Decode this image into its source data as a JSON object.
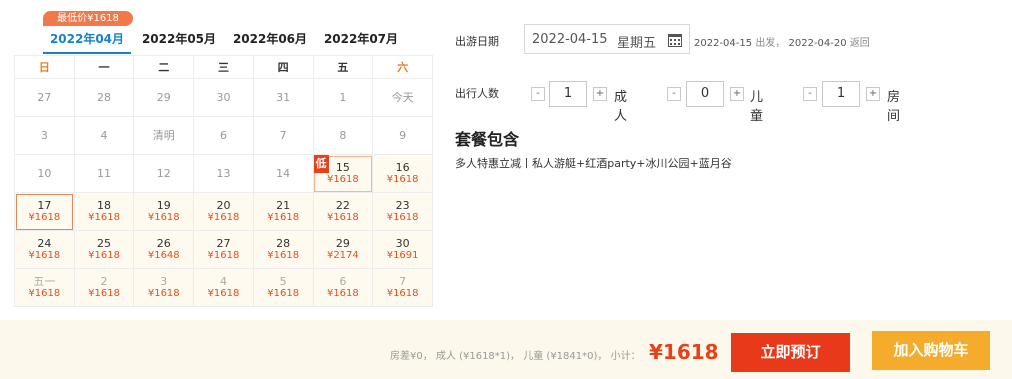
{
  "lowest_badge": "最低价¥1618",
  "months": [
    "2022年04月",
    "2022年05月",
    "2022年06月",
    "2022年07月"
  ],
  "weekdays": [
    "日",
    "一",
    "二",
    "三",
    "四",
    "五",
    "六"
  ],
  "calendar": [
    [
      {
        "d": "27",
        "p": "",
        "s": "past"
      },
      {
        "d": "28",
        "p": "",
        "s": "past"
      },
      {
        "d": "29",
        "p": "",
        "s": "past"
      },
      {
        "d": "30",
        "p": "",
        "s": "past"
      },
      {
        "d": "31",
        "p": "",
        "s": "past"
      },
      {
        "d": "1",
        "p": "",
        "s": "past"
      },
      {
        "d": "今天",
        "p": "",
        "s": "past"
      }
    ],
    [
      {
        "d": "3",
        "p": "",
        "s": "past"
      },
      {
        "d": "4",
        "p": "",
        "s": "past"
      },
      {
        "d": "清明",
        "p": "",
        "s": "past"
      },
      {
        "d": "6",
        "p": "",
        "s": "past"
      },
      {
        "d": "7",
        "p": "",
        "s": "past"
      },
      {
        "d": "8",
        "p": "",
        "s": "past"
      },
      {
        "d": "9",
        "p": "",
        "s": "past"
      }
    ],
    [
      {
        "d": "10",
        "p": "",
        "s": "past"
      },
      {
        "d": "11",
        "p": "",
        "s": "past"
      },
      {
        "d": "12",
        "p": "",
        "s": "past"
      },
      {
        "d": "13",
        "p": "",
        "s": "past"
      },
      {
        "d": "14",
        "p": "",
        "s": "past"
      },
      {
        "d": "15",
        "p": "¥1618",
        "s": "avail",
        "low": "低",
        "sel": "sel2"
      },
      {
        "d": "16",
        "p": "¥1618",
        "s": "avail"
      }
    ],
    [
      {
        "d": "17",
        "p": "¥1618",
        "s": "avail",
        "sel": "sel"
      },
      {
        "d": "18",
        "p": "¥1618",
        "s": "avail"
      },
      {
        "d": "19",
        "p": "¥1618",
        "s": "avail"
      },
      {
        "d": "20",
        "p": "¥1618",
        "s": "avail"
      },
      {
        "d": "21",
        "p": "¥1618",
        "s": "avail"
      },
      {
        "d": "22",
        "p": "¥1618",
        "s": "avail"
      },
      {
        "d": "23",
        "p": "¥1618",
        "s": "avail"
      }
    ],
    [
      {
        "d": "24",
        "p": "¥1618",
        "s": "avail"
      },
      {
        "d": "25",
        "p": "¥1618",
        "s": "avail"
      },
      {
        "d": "26",
        "p": "¥1648",
        "s": "avail"
      },
      {
        "d": "27",
        "p": "¥1618",
        "s": "avail"
      },
      {
        "d": "28",
        "p": "¥1618",
        "s": "avail"
      },
      {
        "d": "29",
        "p": "¥2174",
        "s": "avail"
      },
      {
        "d": "30",
        "p": "¥1691",
        "s": "avail"
      }
    ],
    [
      {
        "d": "五一",
        "p": "¥1618",
        "s": "next"
      },
      {
        "d": "2",
        "p": "¥1618",
        "s": "next"
      },
      {
        "d": "3",
        "p": "¥1618",
        "s": "next"
      },
      {
        "d": "4",
        "p": "¥1618",
        "s": "next"
      },
      {
        "d": "5",
        "p": "¥1618",
        "s": "next"
      },
      {
        "d": "6",
        "p": "¥1618",
        "s": "next"
      },
      {
        "d": "7",
        "p": "¥1618",
        "s": "next"
      }
    ]
  ],
  "form": {
    "date_label": "出游日期",
    "date_value": "2022-04-15",
    "date_weekday": "星期五",
    "depart": "2022-04-15",
    "depart_suffix": "出发，",
    "return": "2022-04-20",
    "return_suffix": "返回",
    "people_label": "出行人数",
    "adults": "1",
    "adults_label": "成人",
    "children": "0",
    "children_label": "儿童",
    "rooms": "1",
    "rooms_label": "房间",
    "minus": "-",
    "plus": "+"
  },
  "package": {
    "title": "套餐包含",
    "desc": "多人特惠立减丨私人游艇+红酒party+冰川公园+蓝月谷"
  },
  "footer": {
    "summary": "房差¥0， 成人 (¥1618*1)， 儿童 (¥1841*0)， 小计：",
    "total": "¥1618",
    "book": "立即预订",
    "cart": "加入购物车"
  },
  "colors": {
    "accent": "#1a82c4",
    "price": "#e4501c",
    "book": "#e8391a",
    "cart": "#f5ac2d"
  }
}
